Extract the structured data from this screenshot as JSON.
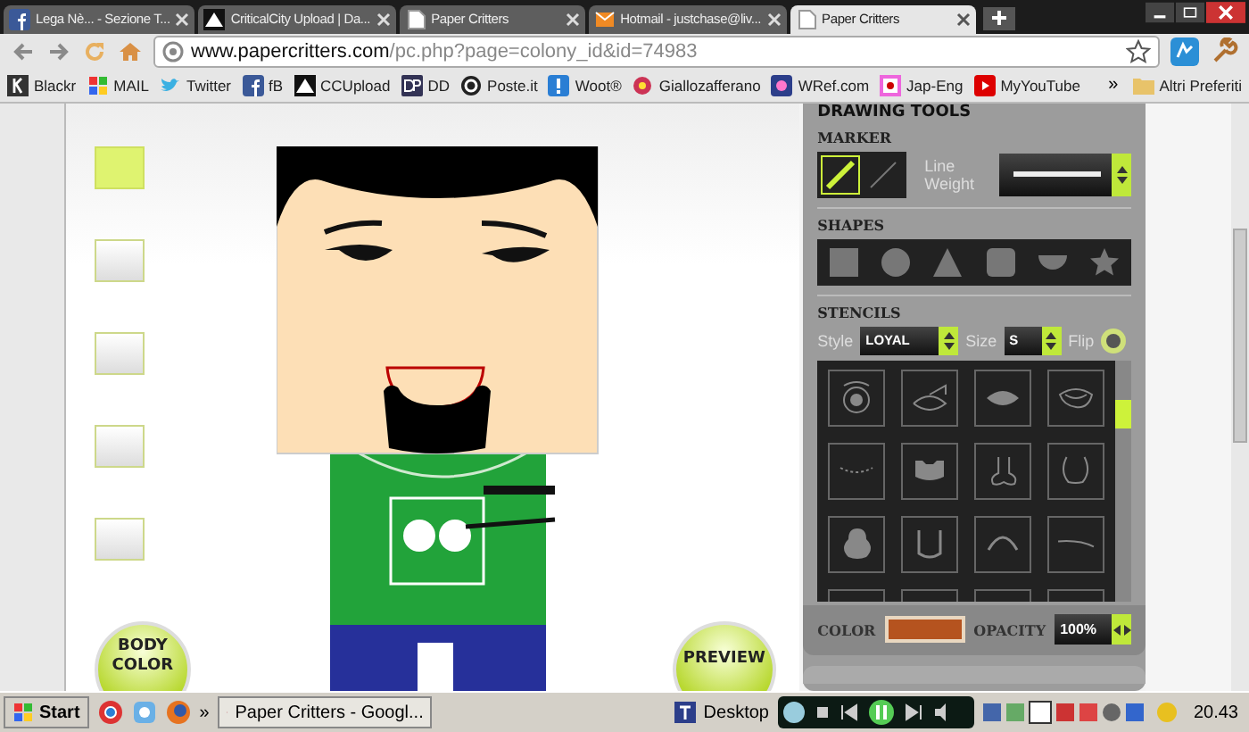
{
  "browser": {
    "tabs": [
      {
        "title": "Lega Nè... - Sezione T...",
        "selected": false
      },
      {
        "title": "CriticalCity Upload | Da...",
        "selected": false
      },
      {
        "title": "Paper Critters",
        "selected": false
      },
      {
        "title": "Hotmail - justchase@liv...",
        "selected": false
      },
      {
        "title": "Paper Critters",
        "selected": true
      }
    ],
    "url_domain": "www.papercritters.com",
    "url_path": "/pc.php?page=colony_id&id=74983",
    "bookmarks": [
      "Blackr",
      "MAIL",
      "Twitter",
      "fB",
      "CCUpload",
      "DD",
      "Poste.it",
      "Woot®",
      "Giallozafferano",
      "WRef.com",
      "Jap-Eng",
      "MyYouTube"
    ],
    "bookmarks_more": "»",
    "other_bookmarks": "Altri Preferiti"
  },
  "page": {
    "body_parts": [
      {
        "selected": true
      },
      {
        "selected": false
      },
      {
        "selected": false
      },
      {
        "selected": false
      },
      {
        "selected": false
      }
    ],
    "body_color_button": "BODY COLOR",
    "preview_button": "PREVIEW",
    "tools": {
      "title": "DRAWING TOOLS",
      "marker_label": "MARKER",
      "markers": [
        {
          "kind": "thick",
          "selected": true
        },
        {
          "kind": "thin",
          "selected": false
        }
      ],
      "line_weight_label": "Line Weight",
      "shapes_label": "SHAPES",
      "shapes": [
        {
          "kind": "square"
        },
        {
          "kind": "circle"
        },
        {
          "kind": "triangle"
        },
        {
          "kind": "rounded"
        },
        {
          "kind": "half"
        },
        {
          "kind": "star"
        }
      ],
      "stencils_label": "STENCILS",
      "style_label": "Style",
      "style_value": "LOYAL",
      "size_label": "Size",
      "size_value": "S",
      "flip_label": "Flip",
      "color_label": "COLOR",
      "color": "#b5531f",
      "opacity_label": "OPACITY",
      "opacity_value": "100%"
    }
  },
  "taskbar": {
    "start": "Start",
    "quick_more": "»",
    "task": "Paper Critters - Googl...",
    "desktop": "Desktop",
    "clock": "20.43"
  }
}
